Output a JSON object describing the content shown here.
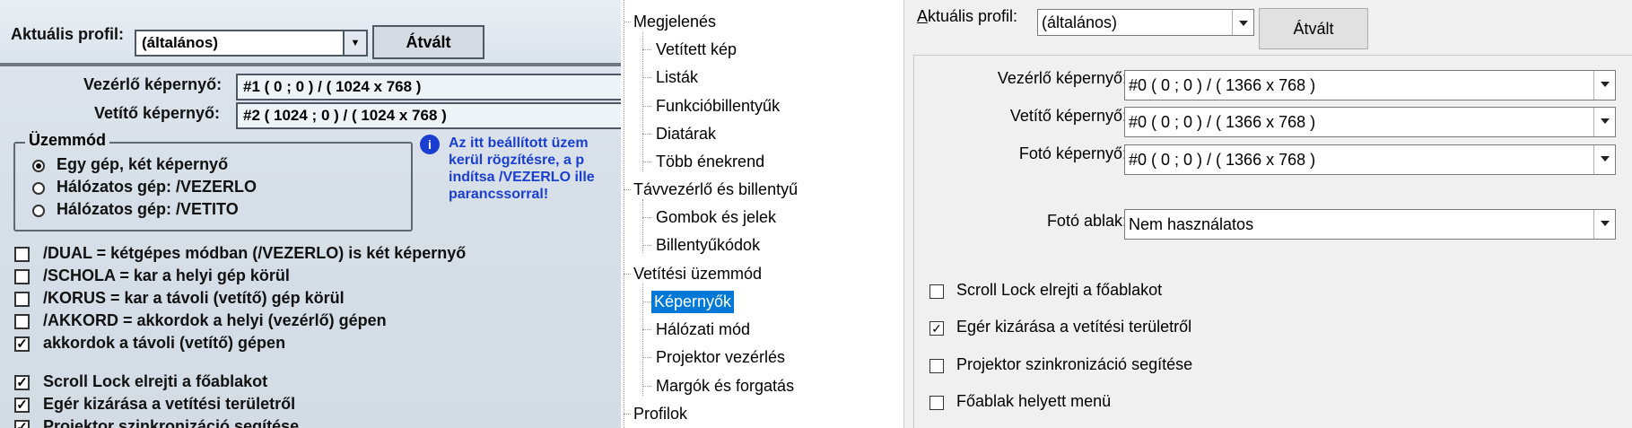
{
  "photo": {
    "profile_label": "Aktuális profil:",
    "profile_value": "(általános)",
    "switch_button": "Átvált",
    "control_screen_label": "Vezérlő képernyő:",
    "control_screen_value": "#1 ( 0 ; 0 ) / ( 1024 x 768 )",
    "projector_screen_label": "Vetítő képernyő:",
    "projector_screen_value": "#2 ( 1024 ; 0 ) / ( 1024 x 768 )",
    "mode_group": "Üzemmód",
    "modes": [
      {
        "label": "Egy gép, két képernyő",
        "selected": true
      },
      {
        "label": "Hálózatos gép: /VEZERLO",
        "selected": false
      },
      {
        "label": "Hálózatos gép: /VETITO",
        "selected": false
      }
    ],
    "info_lines": [
      "Az itt beállított üzem",
      "kerül rögzítésre, a p",
      "indítsa /VEZERLO ille",
      "parancssorral!"
    ],
    "checkboxes": [
      {
        "label": "/DUAL = kétgépes módban (/VEZERLO) is két képernyő",
        "checked": false
      },
      {
        "label": "/SCHOLA = kar a helyi gép körül",
        "checked": false
      },
      {
        "label": "/KORUS = kar a távoli (vetítő) gép körül",
        "checked": false
      },
      {
        "label": "/AKKORD = akkordok a helyi (vezérlő) gépen",
        "checked": false
      },
      {
        "label": "akkordok a távoli (vetítő) gépen",
        "checked": true
      },
      {
        "label": "Scroll Lock elrejti a főablakot",
        "checked": true
      },
      {
        "label": "Egér kizárása a vetítési területről",
        "checked": true
      },
      {
        "label": "Projektor szinkronizáció segítése",
        "checked": true
      }
    ]
  },
  "tree": {
    "items": [
      {
        "label": "Megjelenés",
        "level": 0
      },
      {
        "label": "Vetített kép",
        "level": 1
      },
      {
        "label": "Listák",
        "level": 1
      },
      {
        "label": "Funkcióbillentyűk",
        "level": 1
      },
      {
        "label": "Diatárak",
        "level": 1
      },
      {
        "label": "Több énekrend",
        "level": 1
      },
      {
        "label": "Távvezérlő és billentyű",
        "level": 0
      },
      {
        "label": "Gombok és jelek",
        "level": 1
      },
      {
        "label": "Billentyűkódok",
        "level": 1
      },
      {
        "label": "Vetítési üzemmód",
        "level": 0
      },
      {
        "label": "Képernyők",
        "level": 1,
        "selected": true
      },
      {
        "label": "Hálózati mód",
        "level": 1
      },
      {
        "label": "Projektor vezérlés",
        "level": 1
      },
      {
        "label": "Margók és forgatás",
        "level": 1
      },
      {
        "label": "Profilok",
        "level": 0
      }
    ]
  },
  "right": {
    "profile_label": "Aktuális profil:",
    "profile_value": "(általános)",
    "switch_button": "Átvált",
    "control_screen_label": "Vezérlő képernyő:",
    "control_screen_value": "#0 ( 0 ; 0 ) / ( 1366 x 768 )",
    "projector_screen_label": "Vetítő képernyő:",
    "projector_screen_value": "#0 ( 0 ; 0 ) / ( 1366 x 768 )",
    "photo_screen_label": "Fotó képernyő:",
    "photo_screen_value": "#0 ( 0 ; 0 ) / ( 1366 x 768 )",
    "photo_window_label": "Fotó ablak:",
    "photo_window_value": "Nem használatos",
    "checkboxes": [
      {
        "label": "Scroll Lock elrejti a főablakot",
        "checked": false
      },
      {
        "label": "Egér kizárása a vetítési területről",
        "checked": true
      },
      {
        "label": "Projektor szinkronizáció segítése",
        "checked": false
      },
      {
        "label": "Főablak helyett menü",
        "checked": false
      }
    ]
  },
  "colors": {
    "selection": "#0078d7",
    "info_text": "#1a3fd0",
    "panel_bg": "#f0f0f0"
  }
}
